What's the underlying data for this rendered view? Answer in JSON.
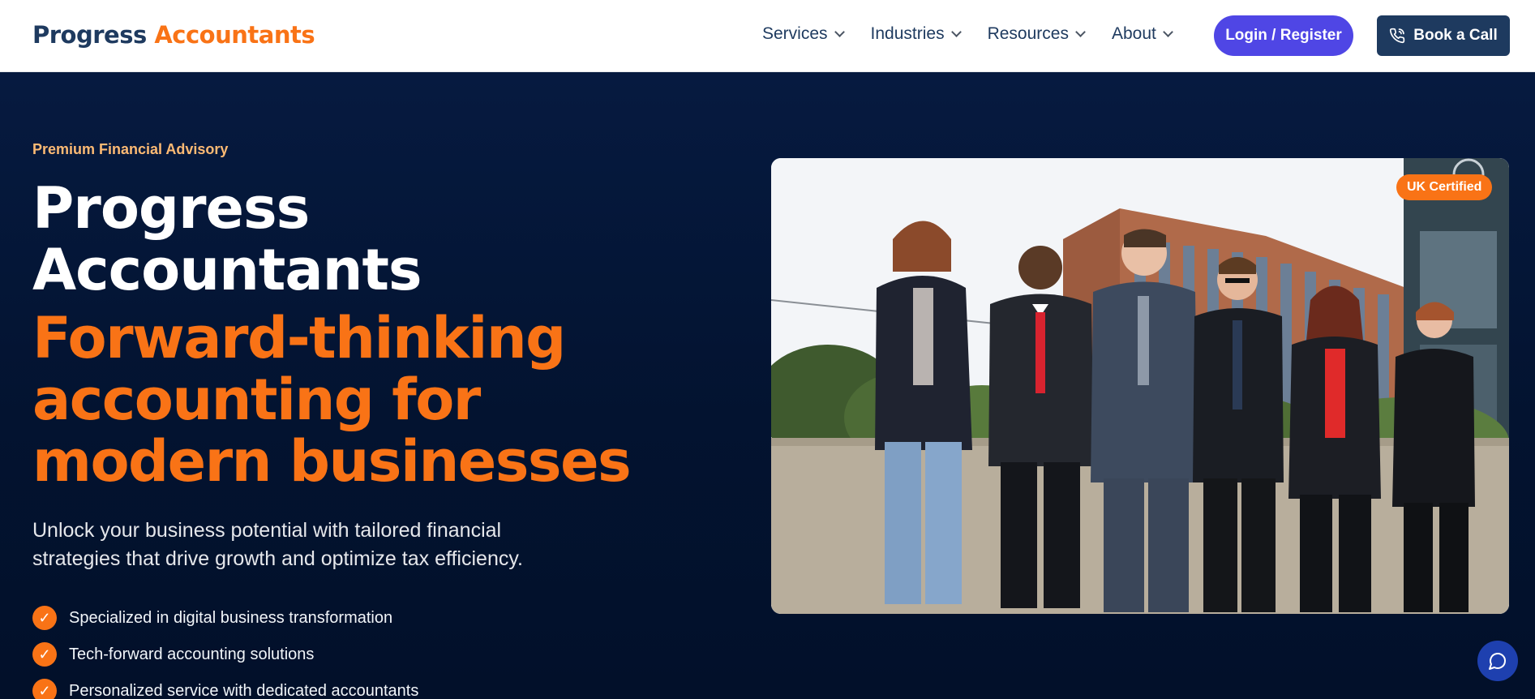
{
  "brand": {
    "part1": "Progress",
    "part2": "Accountants"
  },
  "nav": {
    "items": [
      {
        "label": "Services",
        "icon": "chevron-down-icon"
      },
      {
        "label": "Industries",
        "icon": "chevron-down-icon"
      },
      {
        "label": "Resources",
        "icon": "chevron-down-icon"
      },
      {
        "label": "About",
        "icon": "chevron-down-icon"
      }
    ],
    "login_label": "Login / Register",
    "book_label": "Book a Call",
    "book_icon": "phone-icon"
  },
  "hero": {
    "eyebrow": "Premium Financial Advisory",
    "title_line1": "Progress",
    "title_line2": "Accountants",
    "tagline_line1": "Forward-thinking",
    "tagline_line2": "accounting for",
    "tagline_line3": "modern businesses",
    "subtitle_line1": "Unlock your business potential with tailored financial",
    "subtitle_line2": "strategies that drive growth and optimize tax efficiency.",
    "features": [
      "Specialized in digital business transformation",
      "Tech-forward accounting solutions",
      "Personalized service with dedicated accountants"
    ],
    "check_glyph": "✓",
    "badge": "UK Certified",
    "chat_icon": "chat-bubble-icon"
  },
  "colors": {
    "navy": "#1e3a5f",
    "orange": "#f97316",
    "indigo": "#4f46e5",
    "hero_bg": "#031330"
  }
}
